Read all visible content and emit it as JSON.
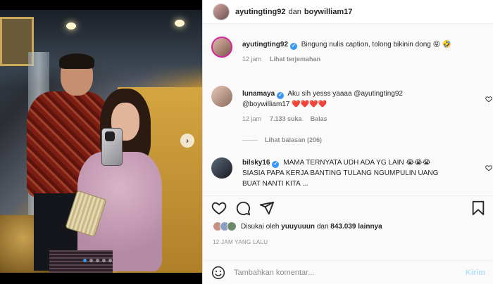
{
  "header": {
    "user1": "ayutingting92",
    "connector": "dan",
    "user2": "boywilliam17"
  },
  "comments": [
    {
      "username": "ayutingting92",
      "verified": true,
      "text": "Bingung nulis caption, tolong bikinin dong",
      "emojis": "😝 🤣",
      "time": "12 jam",
      "action": "Lihat terjemahan"
    },
    {
      "username": "lunamaya",
      "verified": true,
      "text_part1": "Aku sih yesss yaaaa @ayutingting92",
      "text_part2": "@boywilliam17",
      "hearts": "❤️❤️❤️❤️",
      "time": "12 jam",
      "likes": "7.133 suka",
      "reply": "Balas",
      "view_replies": "Lihat balasan (206)"
    },
    {
      "username": "bilsky16",
      "verified": true,
      "text_part1": "MAMA TERNYATA UDH ADA YG LAIN",
      "emojis": "😭😭😭",
      "text_part2": "SIASIA PAPA KERJA BANTING TULANG NGUMPULIN UANG",
      "text_part3": "BUAT NANTI KITA ..."
    }
  ],
  "likes": {
    "prefix": "Disukai oleh",
    "user": "yuuyuuun",
    "connector": "dan",
    "count": "843.039 lainnya"
  },
  "timestamp": "12 JAM YANG LALU",
  "comment_box": {
    "placeholder": "Tambahkan komentar...",
    "post_label": "Kirim"
  },
  "photo": {
    "next_glyph": "›",
    "dots": 5,
    "active_dot": 0
  }
}
